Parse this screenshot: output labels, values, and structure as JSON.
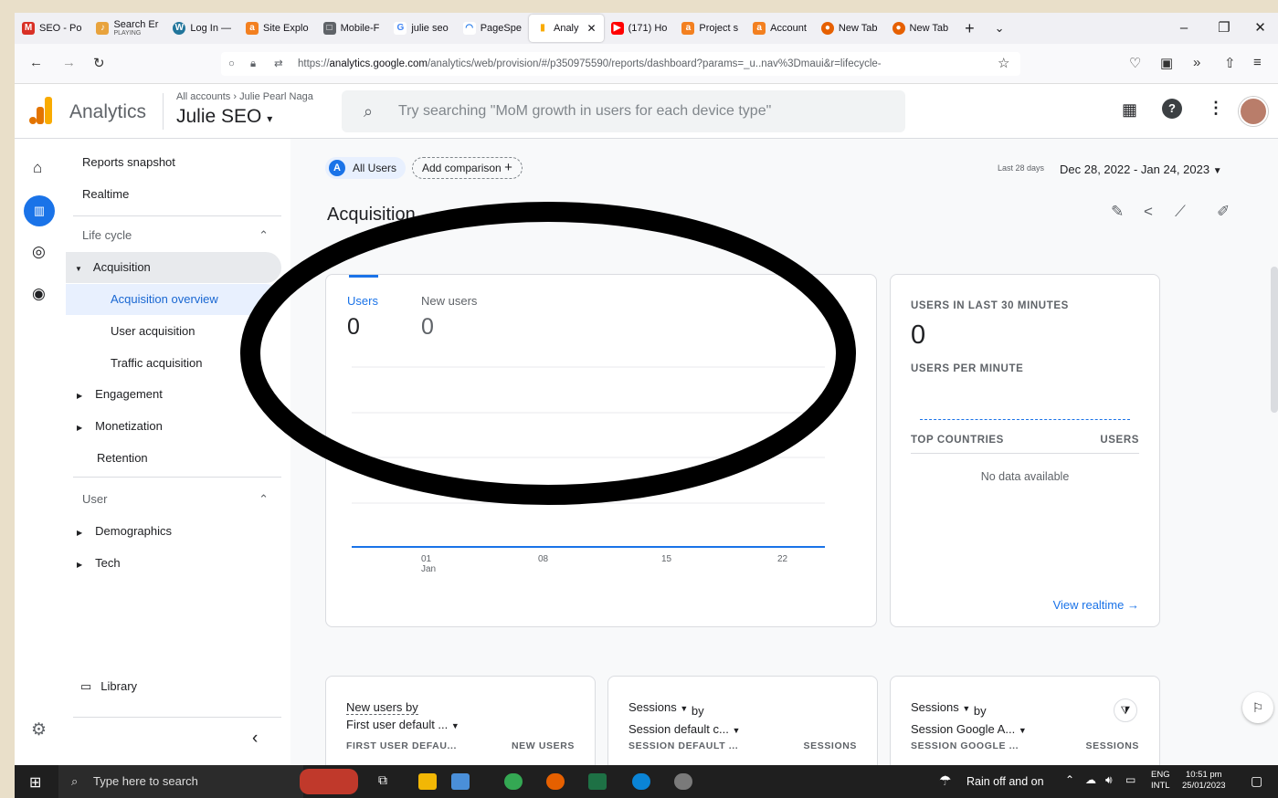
{
  "browser": {
    "tabs": [
      {
        "icon": "gmail-icon",
        "color": "#d93025",
        "glyph": "M",
        "label": "SEO - Po"
      },
      {
        "icon": "music-icon",
        "color": "#e8a33d",
        "glyph": "♪",
        "label": "Search Er",
        "sublabel": "PLAYING"
      },
      {
        "icon": "wordpress-icon",
        "color": "#21759b",
        "glyph": "W",
        "label": "Log In —"
      },
      {
        "icon": "ahrefs-icon",
        "color": "#f38020",
        "glyph": "a",
        "label": "Site Explo"
      },
      {
        "icon": "mobile-icon",
        "color": "#5f6368",
        "glyph": "□",
        "label": "Mobile-F"
      },
      {
        "icon": "google-icon",
        "color": "#4285f4",
        "glyph": "G",
        "label": "julie seo"
      },
      {
        "icon": "pagespeed-icon",
        "color": "#1a73e8",
        "glyph": "◠",
        "label": "PageSpe"
      },
      {
        "icon": "analytics-icon",
        "color": "#f9ab00",
        "glyph": "▮",
        "label": "Analy"
      },
      {
        "icon": "youtube-icon",
        "color": "#ff0000",
        "glyph": "▶",
        "label": "(171) Ho"
      },
      {
        "icon": "ahrefs-icon",
        "color": "#f38020",
        "glyph": "a",
        "label": "Project s"
      },
      {
        "icon": "ahrefs-icon",
        "color": "#f38020",
        "glyph": "a",
        "label": "Account"
      },
      {
        "icon": "firefox-icon",
        "color": "#e66000",
        "glyph": "●",
        "label": "New Tab"
      },
      {
        "icon": "firefox-icon",
        "color": "#e66000",
        "glyph": "●",
        "label": "New Tab"
      }
    ],
    "url_prefix": "https://",
    "url_host": "analytics.google.com",
    "url_path": "/analytics/web/provision/#/p350975590/reports/dashboard?params=_u..nav%3Dmaui&r=lifecycle-"
  },
  "header": {
    "product": "Analytics",
    "breadcrumb": "All accounts",
    "account": "Julie Pearl Naga",
    "property": "Julie SEO",
    "search_placeholder": "Try searching \"MoM growth in users for each device type\""
  },
  "nav": {
    "reports_snapshot": "Reports snapshot",
    "realtime": "Realtime",
    "lifecycle": "Life cycle",
    "acquisition": "Acquisition",
    "acq_overview": "Acquisition overview",
    "user_acq": "User acquisition",
    "traffic_acq": "Traffic acquisition",
    "engagement": "Engagement",
    "monetization": "Monetization",
    "retention": "Retention",
    "user": "User",
    "demographics": "Demographics",
    "tech": "Tech",
    "library": "Library"
  },
  "toolbar": {
    "segment_badge": "A",
    "segment": "All Users",
    "add_comparison": "Add comparison",
    "date_prefix": "Last 28 days",
    "date_range": "Dec 28, 2022 - Jan 24, 2023"
  },
  "page": {
    "title": "Acquisition"
  },
  "users_card": {
    "m1_label": "Users",
    "m1_value": "0",
    "m2_label": "New users",
    "m2_value": "0",
    "x_ticks": [
      "01",
      "08",
      "15",
      "22"
    ],
    "x_month": "Jan"
  },
  "realtime_card": {
    "title": "USERS IN LAST 30 MINUTES",
    "value": "0",
    "sub": "USERS PER MINUTE",
    "col1": "TOP COUNTRIES",
    "col2": "USERS",
    "empty": "No data available",
    "link": "View realtime"
  },
  "bottom_cards": [
    {
      "metric": "New users by",
      "dim": "First user default ...",
      "col1": "FIRST USER DEFAU...",
      "col2": "NEW USERS"
    },
    {
      "metric": "Sessions",
      "by": "by",
      "dim": "Session default c...",
      "col1": "SESSION DEFAULT ...",
      "col2": "SESSIONS"
    },
    {
      "metric": "Sessions",
      "by": "by",
      "dim": "Session Google A...",
      "col1": "SESSION GOOGLE ...",
      "col2": "SESSIONS"
    }
  ],
  "taskbar": {
    "search": "Type here to search",
    "weather": "Rain off and on",
    "lang1": "ENG",
    "lang2": "INTL",
    "time": "10:51 pm",
    "date": "25/01/2023"
  }
}
